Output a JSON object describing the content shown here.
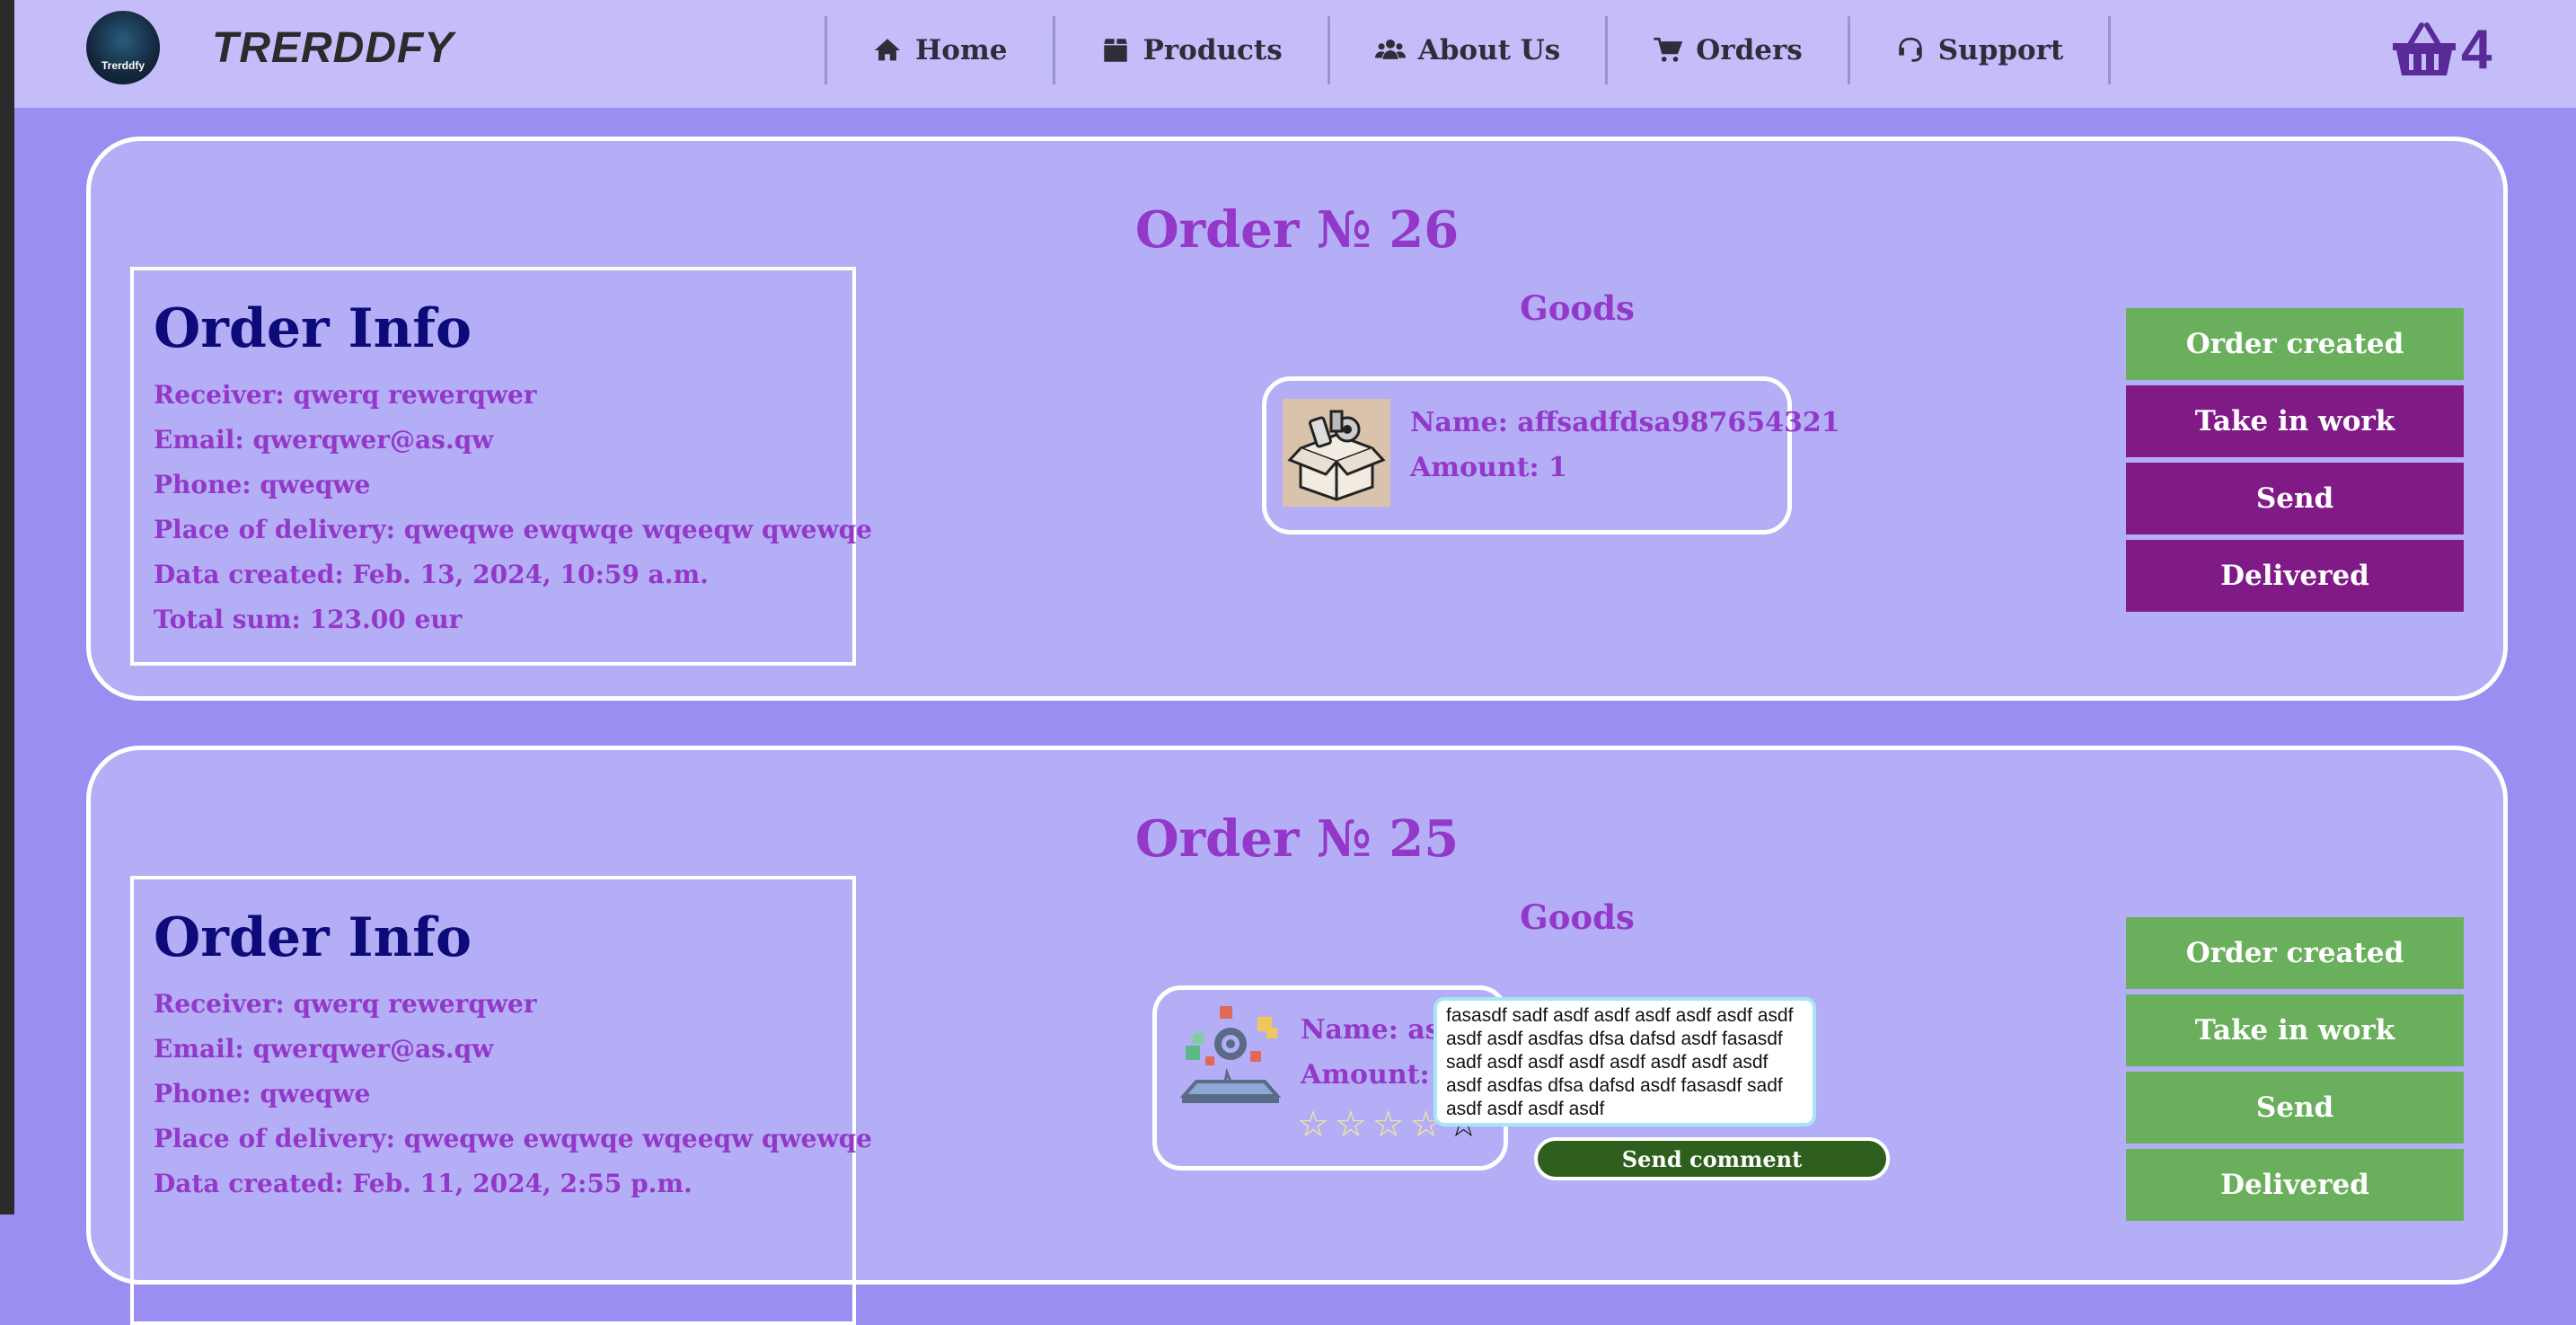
{
  "app": {
    "brand": "TRERDDFY",
    "logo_text": "Trerddfy"
  },
  "nav": {
    "items": [
      {
        "label": "Home",
        "icon": "home-icon"
      },
      {
        "label": "Products",
        "icon": "box-icon"
      },
      {
        "label": "About Us",
        "icon": "users-icon"
      },
      {
        "label": "Orders",
        "icon": "cart-icon"
      },
      {
        "label": "Support",
        "icon": "headset-icon"
      }
    ]
  },
  "cart": {
    "count": "4",
    "icon": "basket-icon"
  },
  "colors": {
    "active_green": "#6aaf5c",
    "inactive_purple": "#7f1a86",
    "accent_purple": "#9338c8",
    "heading_navy": "#0d0b7a"
  },
  "orders": [
    {
      "title": "Order № 26",
      "info": {
        "heading": "Order Info",
        "receiver": "Receiver: qwerq rewerqwer",
        "email": "Email: qwerqwer@as.qw",
        "phone": "Phone: qweqwe",
        "place": "Place of delivery: qweqwe ewqwqe wqeeqw qwewqe",
        "date": "Data created: Feb. 13, 2024, 10:59 a.m.",
        "total": "Total sum: 123.00 eur"
      },
      "goods_label": "Goods",
      "goods": [
        {
          "name": "Name: affsadfdsa987654321",
          "amount": "Amount: 1"
        }
      ],
      "statuses": [
        "Order created",
        "Take in work",
        "Send",
        "Delivered"
      ],
      "status_active": [
        true,
        false,
        false,
        false
      ]
    },
    {
      "title": "Order № 25",
      "info": {
        "heading": "Order Info",
        "receiver": "Receiver: qwerq rewerqwer",
        "email": "Email: qwerqwer@as.qw",
        "phone": "Phone: qweqwe",
        "place": "Place of delivery: qweqwe ewqwqe wqeeqw qwewqe",
        "date": "Data created: Feb. 11, 2024, 2:55 p.m."
      },
      "goods_label": "Goods",
      "goods": [
        {
          "name": "Name: asdf",
          "amount": "Amount: 2",
          "rating": 4,
          "rating_max": 5
        }
      ],
      "comment": "fasasdf sadf asdf asdf asdf asdf asdf asdf asdf asdf asdfas dfsa dafsd asdf fasasdf sadf asdf asdf asdf asdf asdf asdf asdf asdf asdfas dfsa dafsd asdf fasasdf sadf asdf asdf asdf asdf",
      "send_comment_label": "Send comment",
      "statuses": [
        "Order created",
        "Take in work",
        "Send",
        "Delivered"
      ],
      "status_active": [
        true,
        true,
        true,
        true
      ]
    }
  ]
}
